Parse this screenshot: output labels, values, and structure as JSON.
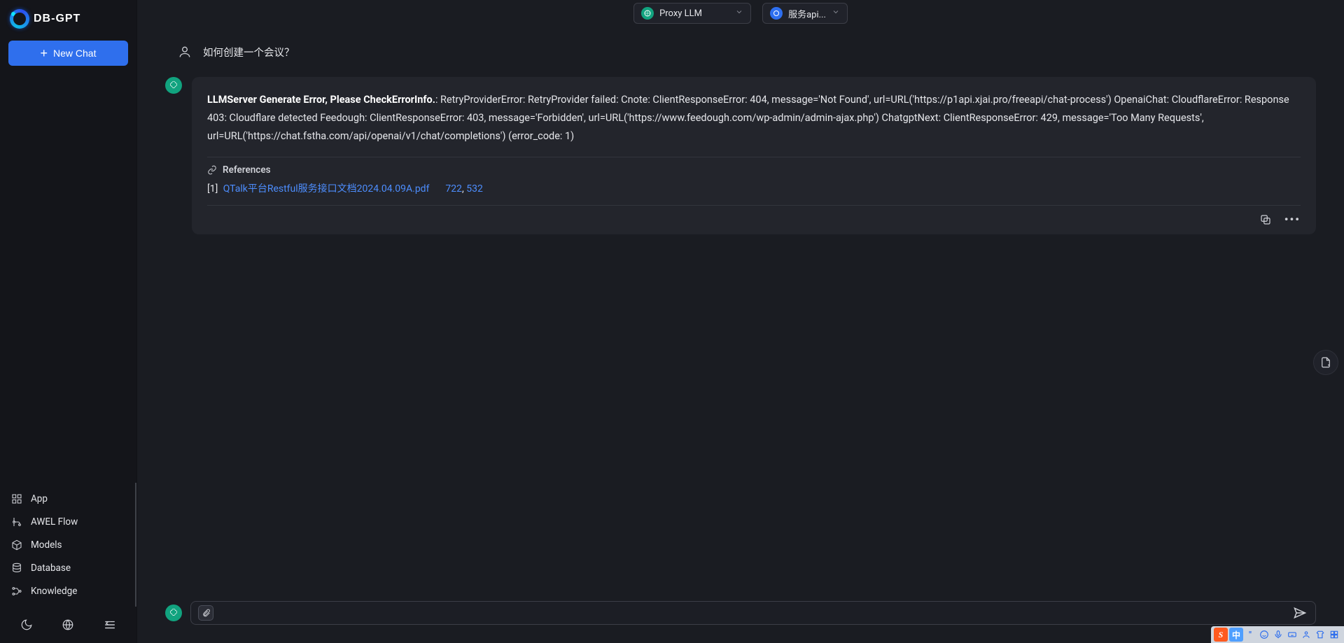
{
  "brand": "DB-GPT",
  "sidebar": {
    "new_chat": "New Chat",
    "items": [
      {
        "label": "App"
      },
      {
        "label": "AWEL Flow"
      },
      {
        "label": "Models"
      },
      {
        "label": "Database"
      },
      {
        "label": "Knowledge"
      }
    ]
  },
  "header": {
    "model_select": {
      "value": "Proxy LLM"
    },
    "service_select": {
      "value": "服务api..."
    }
  },
  "chat": {
    "user_message": "如何创建一个会议？",
    "assistant": {
      "error_title": "LLMServer Generate Error, Please CheckErrorInfo.",
      "error_body": ": RetryProviderError: RetryProvider failed: Cnote: ClientResponseError: 404, message='Not Found', url=URL('https://p1api.xjai.pro/freeapi/chat-process') OpenaiChat: CloudflareError: Response 403: Cloudflare detected Feedough: ClientResponseError: 403, message='Forbidden', url=URL('https://www.feedough.com/wp-admin/admin-ajax.php') ChatgptNext: ClientResponseError: 429, message='Too Many Requests', url=URL('https://chat.fstha.com/api/openai/v1/chat/completions') (error_code: 1)",
      "references_label": "References",
      "references": [
        {
          "index": "[1]",
          "title": "QTalk平台Restful服务接口文档2024.04.09A.pdf",
          "page_a": "722",
          "page_b": "532"
        }
      ]
    }
  },
  "composer": {
    "placeholder": ""
  },
  "tray": {
    "ime": "中",
    "sogou": "S",
    "cn": "中"
  }
}
